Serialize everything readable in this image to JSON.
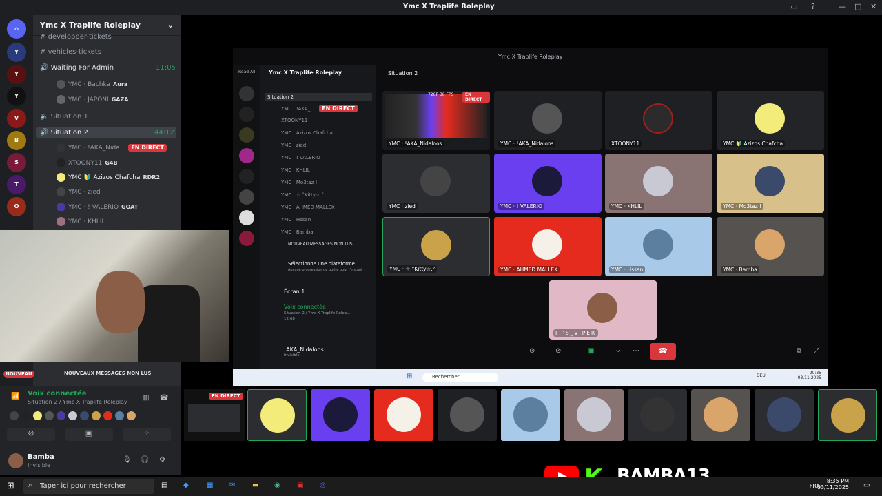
{
  "window": {
    "title": "Ymc X Traplife Roleplay"
  },
  "sidebar": {
    "server_name": "Ymc X Traplife Roleplay",
    "channels": [
      {
        "name": "developper-tickets"
      },
      {
        "name": "vehicles-tickets"
      }
    ],
    "voice_waiting": {
      "name": "Waiting For Admin",
      "time": "11:05"
    },
    "waiting_users": [
      {
        "name": "YMC · Bachka",
        "tag": "Aura"
      },
      {
        "name": "YMC · JAPONI",
        "tag": "GAZA"
      }
    ],
    "situation1": "Situation 1",
    "situation2": {
      "name": "Situation 2",
      "time": "44:12"
    },
    "voice_users": [
      {
        "name": "YMC · !AKA_Nida...",
        "live": "EN DIRECT"
      },
      {
        "name": "XTOONY11",
        "tag": "G4B"
      },
      {
        "name": "YMC 🔰 Azizos Chafcha",
        "tag": "RDR2"
      },
      {
        "name": "YMC · zied"
      },
      {
        "name": "YMC · ! VALERIO",
        "tag": "GOAT"
      },
      {
        "name": "YMC · KHLIL"
      }
    ],
    "new_messages_pill": "NOUVEAUX MESSAGES NON LUS",
    "new_badge": "NOUVEAU"
  },
  "voice_panel": {
    "status": "Voix connectée",
    "sub": "Situation 2 / Ymc X Traplife Roleplay",
    "user_name": "Bamba",
    "user_status": "Invisible"
  },
  "shared_screen": {
    "title": "Ymc X Traplife Roleplay",
    "server_name": "Ymc X Traplife Roleplay",
    "read_all": "Read All",
    "channel_title": "Situation 2",
    "channel_list": [
      "Situation 2",
      "YMC · !AKA_...",
      "XTOONY11",
      "YMC · Azizos Chafcha",
      "YMC · zied",
      "YMC · ! VALERIO",
      "YMC · KHLIL",
      "YMC · Mo3taz !",
      "YMC · ☆.°Kitty☆.°",
      "YMC · AHMED MALLEK",
      "YMC · Hssan",
      "YMC · Bamba"
    ],
    "live_badge": "EN DIRECT",
    "new_pill": "NOUVEAU MESSAGES NON LUS",
    "platform_title": "Sélectionne une plateforme",
    "platform_sub": "Aucune progression de quête pour l'instant",
    "screen_label": "Écran 1",
    "voice_status": "Voix connectée",
    "voice_sub": "Situation 2 / Ymc X Traplife Rolep...",
    "voice_time": "12:68",
    "bottom_user": "!AKA_Nidaloos",
    "bottom_status": "Invisible",
    "stream_quality": "720P 30 FPS",
    "tiles": [
      {
        "label": "YMC · !AKA_Nidaloos",
        "color": "#1a1b1e",
        "avatar": "#333"
      },
      {
        "label": "YMC · !AKA_Nidaloos",
        "color": "#1f2023",
        "avatar": "#555"
      },
      {
        "label": "XTOONY11",
        "color": "#1f2023",
        "avatar": "#2b2b2b"
      },
      {
        "label": "YMC 🔰 Azizos Chafcha",
        "color": "#232428",
        "avatar": "#f4ec7a"
      },
      {
        "label": "YMC · zied",
        "color": "#2b2d31",
        "avatar": "#444"
      },
      {
        "label": "YMC · ! VALERIO",
        "color": "#6a3ff0",
        "avatar": "#1c1a3a"
      },
      {
        "label": "YMC · KHLIL",
        "color": "#8a7373",
        "avatar": "#c9c9d4"
      },
      {
        "label": "YMC · Mo3taz !",
        "color": "#d8c08a",
        "avatar": "#3b4a6b"
      },
      {
        "label": "YMC · ☆.°Kitty☆.°",
        "color": "#2b2d31",
        "avatar": "#c9a24a"
      },
      {
        "label": "YMC · AHMED MALLEK",
        "color": "#e52b1e",
        "avatar": "#f5f0e8"
      },
      {
        "label": "YMC · Hssan",
        "color": "#a9c9e8",
        "avatar": "#5c7fa0"
      },
      {
        "label": "YMC · Bamba",
        "color": "#55524f",
        "avatar": "#d9a56a"
      },
      {
        "label": "IT'S_VIPER",
        "color": "#e0b8c6",
        "avatar": "#8a5e47"
      }
    ],
    "inner_taskbar": {
      "search": "Rechercher",
      "lang": "DEU",
      "time": "20:35",
      "date": "03.11.2025"
    }
  },
  "thumb_strip": {
    "live_badge": "EN DIRECT",
    "thumbs": [
      {
        "color": "#f4ec7a",
        "bg": "#2b2d31"
      },
      {
        "color": "#1c1a3a",
        "bg": "#6a3ff0"
      },
      {
        "color": "#f5f0e8",
        "bg": "#e52b1e"
      },
      {
        "color": "#555",
        "bg": "#1f2023"
      },
      {
        "color": "#5c7fa0",
        "bg": "#a9c9e8"
      },
      {
        "color": "#c9c9d4",
        "bg": "#8a7373"
      },
      {
        "color": "#333",
        "bg": "#2b2d31"
      },
      {
        "color": "#d9a56a",
        "bg": "#55524f"
      },
      {
        "color": "#3b4a6b",
        "bg": "#2b2d31"
      },
      {
        "color": "#c9a24a",
        "bg": "#2b2d31"
      }
    ]
  },
  "taskbar": {
    "search_placeholder": "Taper ici pour rechercher",
    "lang": "FRA",
    "time": "8:35 PM",
    "date": "03/11/2025"
  },
  "branding": {
    "kick": "K",
    "name": "BAMBA13"
  },
  "colors": {
    "accent": "#5865f2",
    "green": "#23a55a",
    "red": "#da373c",
    "kick": "#53fc18"
  }
}
